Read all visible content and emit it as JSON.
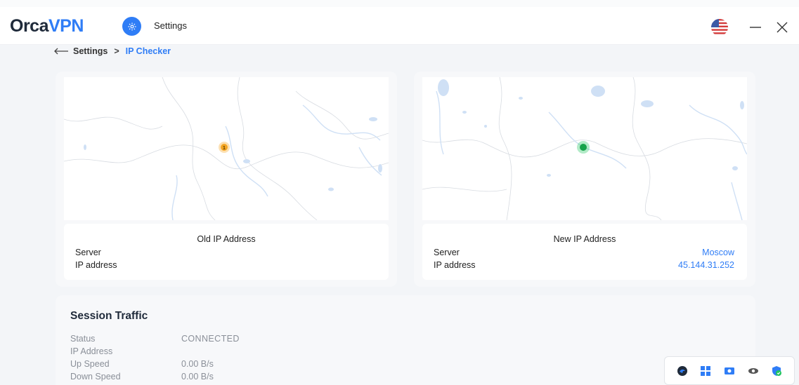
{
  "app": {
    "logo_orca": "Orca",
    "logo_vpn": "VPN",
    "header_title": "Settings",
    "icons": {
      "settings": "gear-icon",
      "flag": "us-flag-icon",
      "minimize": "minimize-icon",
      "close": "close-icon"
    }
  },
  "breadcrumb": {
    "back_icon": "arrow-left-icon",
    "root": "Settings",
    "separator": ">",
    "current": "IP Checker"
  },
  "old_ip": {
    "title": "Old IP Address",
    "server_label": "Server",
    "server_value": "",
    "ip_label": "IP address",
    "ip_value": "",
    "marker_label": "1",
    "marker_color": "#f5a623"
  },
  "new_ip": {
    "title": "New IP Address",
    "server_label": "Server",
    "server_value": "Moscow",
    "ip_label": "IP address",
    "ip_value": "45.144.31.252",
    "marker_color": "#22c55e"
  },
  "traffic": {
    "title": "Session Traffic",
    "rows": [
      {
        "label": "Status",
        "value": "CONNECTED"
      },
      {
        "label": "IP Address",
        "value": ""
      },
      {
        "label": "Up Speed",
        "value": "0.00 B/s"
      },
      {
        "label": "Down Speed",
        "value": "0.00 B/s"
      }
    ]
  },
  "tray": {
    "icons": [
      "orca-vpn-tray-icon",
      "windows-grid-icon",
      "screen-capture-icon",
      "eye-icon",
      "shield-check-icon"
    ]
  },
  "colors": {
    "accent": "#2f7df6",
    "background": "#f3f5f8",
    "panel": "#f7f8fa",
    "map_water": "#cfe0f5",
    "map_border": "#d7dbe1"
  }
}
